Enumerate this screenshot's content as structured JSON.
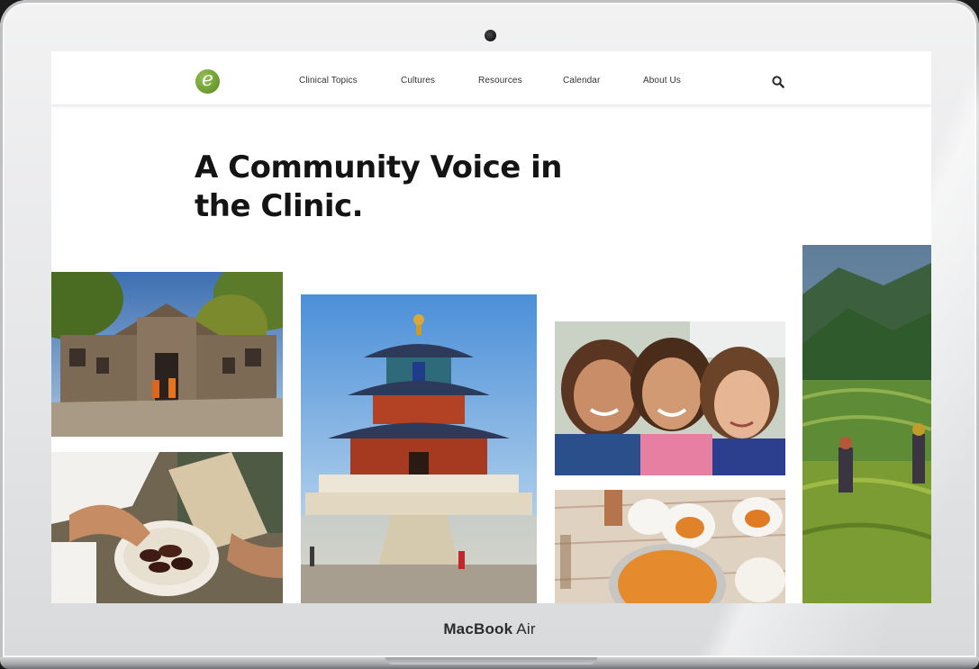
{
  "device": {
    "brand_bold": "MacBook",
    "brand_light": "Air"
  },
  "nav": {
    "logo_letter": "e",
    "items": [
      "Clinical Topics",
      "Cultures",
      "Resources",
      "Calendar",
      "About Us"
    ],
    "search_icon": "search-icon"
  },
  "hero": {
    "headline_line1": "A Community Voice in",
    "headline_line2": "the Clinic."
  },
  "colors": {
    "logo_green": "#6a9a2e",
    "text": "#141414",
    "nav_text": "#333333"
  },
  "photos": [
    {
      "name": "photo-temple-ruins",
      "subject": "stone temple ruins with monks in orange robes"
    },
    {
      "name": "photo-temple-of-heaven",
      "subject": "tiered pagoda temple under blue sky"
    },
    {
      "name": "photo-smiling-children",
      "subject": "three smiling children"
    },
    {
      "name": "photo-rice-terraces",
      "subject": "green rice terraces with farmers"
    },
    {
      "name": "photo-dates-bowl",
      "subject": "hands taking dates from a bowl"
    },
    {
      "name": "photo-shared-meal",
      "subject": "shared meal of rice on plates"
    }
  ]
}
